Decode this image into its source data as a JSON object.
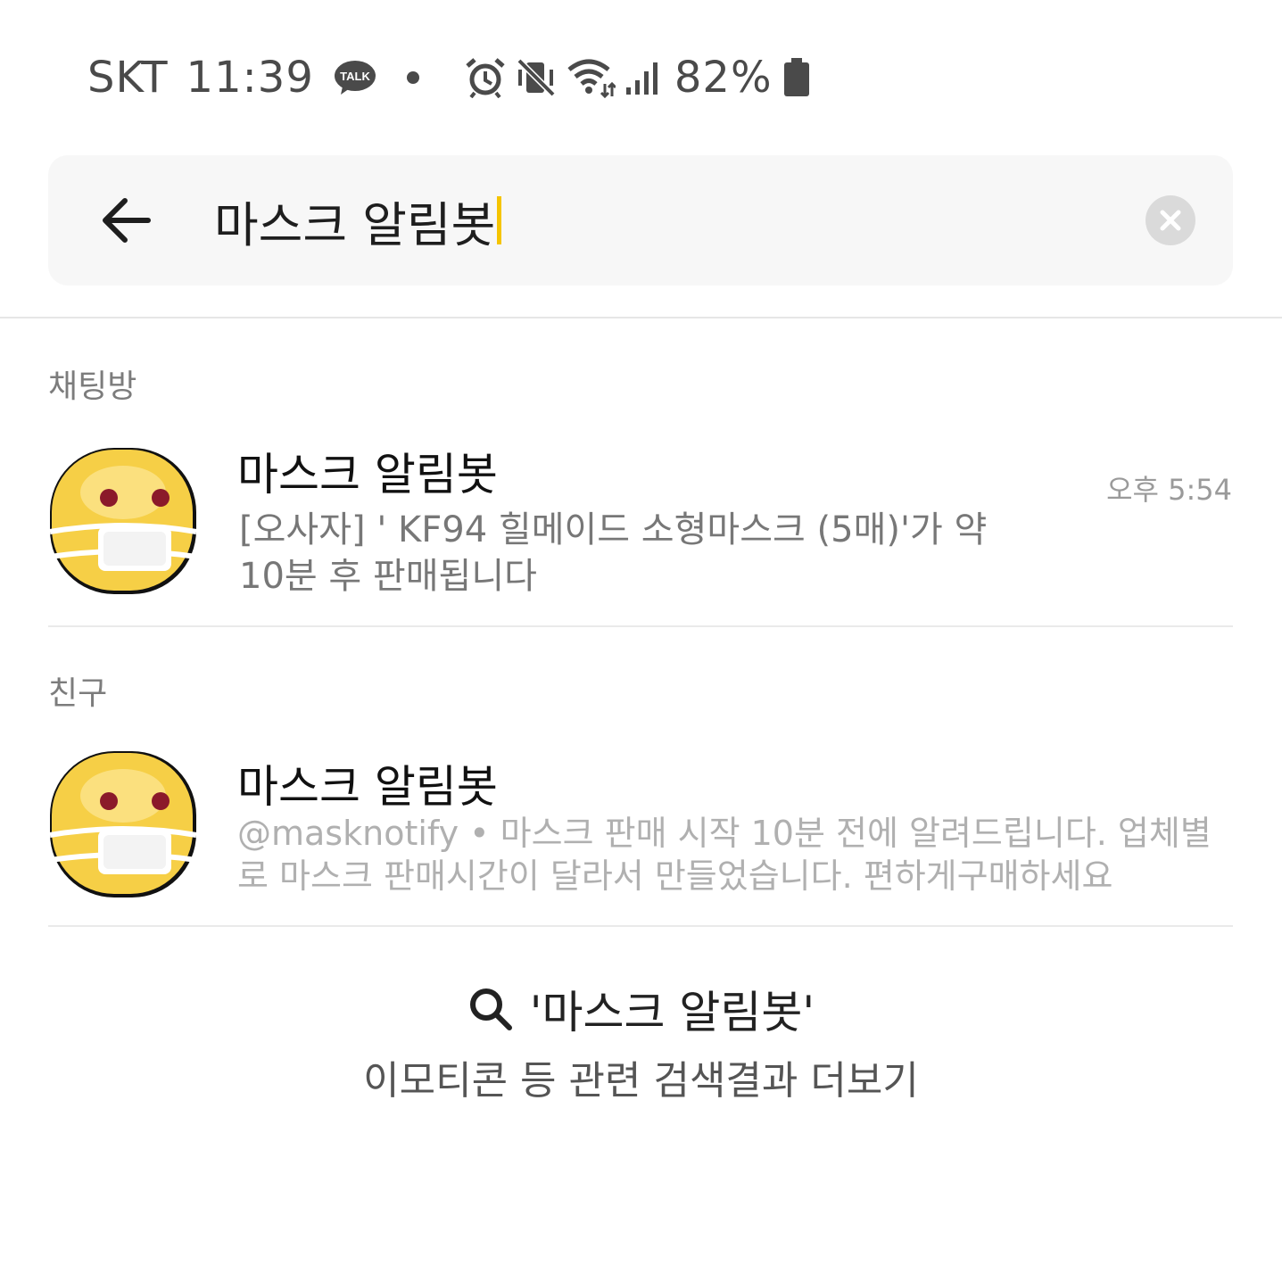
{
  "status_bar": {
    "carrier": "SKT",
    "time": "11:39",
    "battery_percent": "82%",
    "icons": [
      "kakaotalk-talk-icon",
      "notification-dot-icon",
      "alarm-icon",
      "vibrate-mute-icon",
      "wifi-icon",
      "signal-icon",
      "battery-icon"
    ],
    "talk_badge_text": "TALK"
  },
  "search": {
    "query": "마스크 알림봇",
    "accent_color": "#f5c400"
  },
  "sections": {
    "chatrooms_label": "채팅방",
    "friends_label": "친구"
  },
  "chatroom_result": {
    "title": "마스크 알림봇",
    "message": "[오사자] ' KF94 힐메이드 소형마스크 (5매)'가 약 10분 후 판매됩니다",
    "time": "오후 5:54"
  },
  "friend_result": {
    "name": "마스크 알림봇",
    "description": "@masknotify • 마스크 판매 시작 10분 전에 알려드립니다. 업체별로 마스크 판매시간이 달라서 만들었습니다. 편하게구매하세요"
  },
  "more_results": {
    "query_text": "'마스크 알림봇'",
    "label": "이모티콘 등 관련 검색결과 더보기"
  }
}
